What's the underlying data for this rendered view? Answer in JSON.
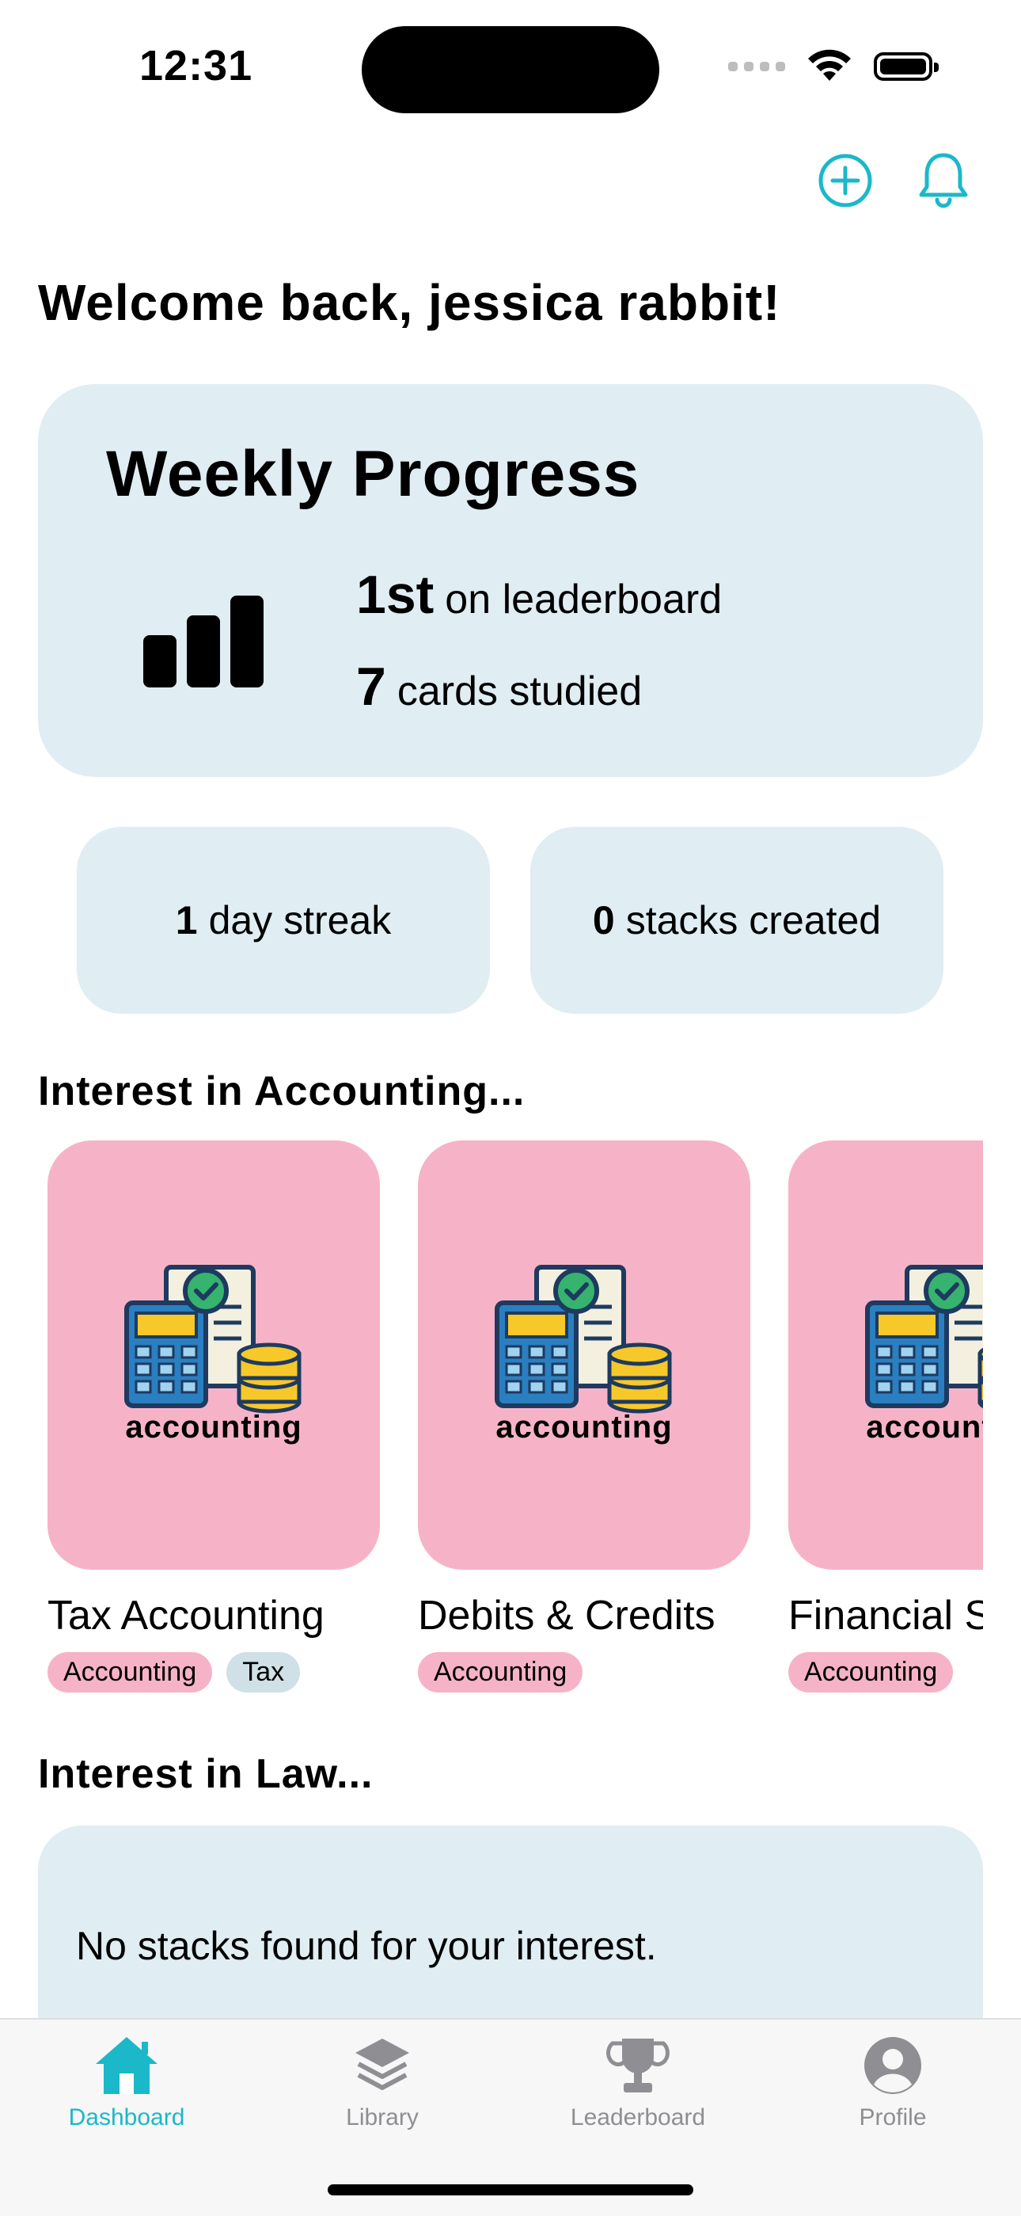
{
  "status": {
    "time": "12:31"
  },
  "header": {
    "add_icon": "plus-circle-icon",
    "bell_icon": "bell-icon",
    "accent": "#1bb8c9"
  },
  "welcome": "Welcome back, jessica rabbit!",
  "weekly": {
    "title": "Weekly Progress",
    "rank": "1st",
    "rank_label": "on leaderboard",
    "cards_count": "7",
    "cards_label": "cards studied"
  },
  "stats": {
    "streak_value": "1",
    "streak_label": "day streak",
    "stacks_value": "0",
    "stacks_label": "stacks created"
  },
  "accounting_section": {
    "title": "Interest in Accounting...",
    "cards": [
      {
        "title": "Tax Accounting",
        "art_word": "accounting",
        "tags": [
          "Accounting",
          "Tax"
        ]
      },
      {
        "title": "Debits & Credits",
        "art_word": "accounting",
        "tags": [
          "Accounting"
        ]
      },
      {
        "title": "Financial S",
        "art_word": "accounting",
        "tags": [
          "Accounting"
        ]
      }
    ]
  },
  "law_section": {
    "title": "Interest in Law...",
    "empty_text": "No stacks found for your interest."
  },
  "tabbar": {
    "items": [
      {
        "label": "Dashboard",
        "icon": "house-icon",
        "active": true
      },
      {
        "label": "Library",
        "icon": "layers-icon",
        "active": false
      },
      {
        "label": "Leaderboard",
        "icon": "trophy-icon",
        "active": false
      },
      {
        "label": "Profile",
        "icon": "person-circle-icon",
        "active": false
      }
    ]
  },
  "colors": {
    "card_bg": "#e0edf3",
    "stack_pink": "#f6b3c8",
    "tag_alt": "#cfe0e6"
  }
}
